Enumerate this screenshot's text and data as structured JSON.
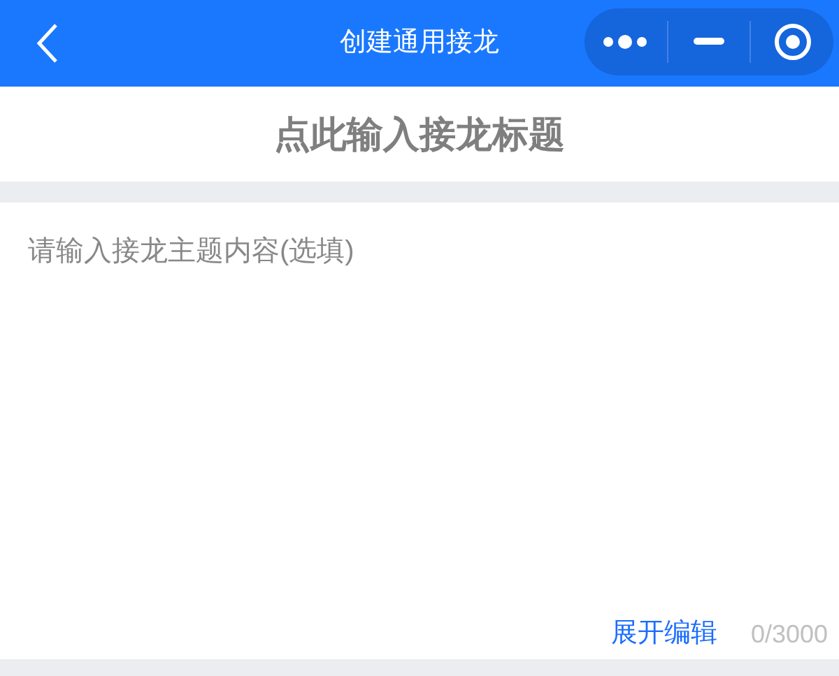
{
  "nav_bar": {
    "title": "创建通用接龙"
  },
  "title_field": {
    "placeholder": "点此输入接龙标题"
  },
  "content_field": {
    "placeholder": "请输入接龙主题内容(选填)"
  },
  "footer": {
    "expand_link": "展开编辑",
    "char_count": "0/3000"
  }
}
